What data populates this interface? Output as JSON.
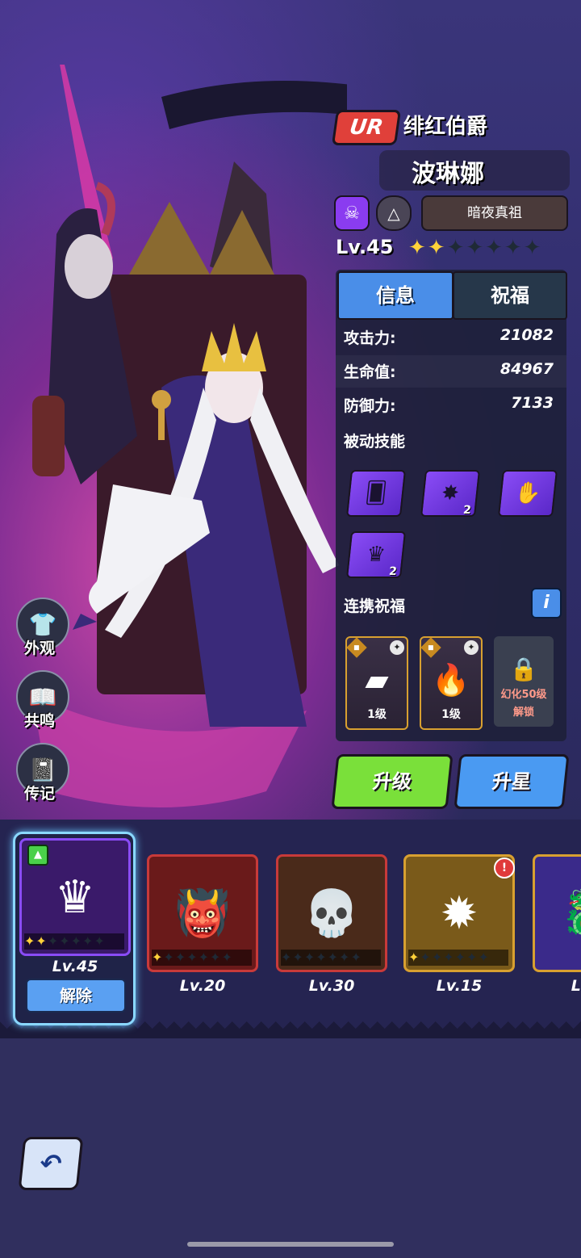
{
  "hero": {
    "rarity": "UR",
    "title": "绯红伯爵",
    "name": "波琳娜",
    "class_icon": "skull-icon",
    "type_icon": "triangle-icon",
    "faction": "暗夜真祖",
    "level": "Lv.45",
    "stars_filled": 2,
    "stars_total": 7
  },
  "tabs": {
    "info": "信息",
    "blessing": "祝福"
  },
  "stats": [
    {
      "label": "攻击力:",
      "value": "21082"
    },
    {
      "label": "生命值:",
      "value": "84967"
    },
    {
      "label": "防御力:",
      "value": "7133"
    }
  ],
  "passive": {
    "title": "被动技能",
    "skills": [
      {
        "icon": "cards-icon",
        "badge": ""
      },
      {
        "icon": "splash-icon",
        "badge": "2"
      },
      {
        "icon": "hand-icon",
        "badge": ""
      },
      {
        "icon": "crown-icon",
        "badge": "2"
      }
    ]
  },
  "link_blessing": {
    "title": "连携祝福",
    "info_label": "i",
    "cards": [
      {
        "icon": "gold-bars-icon",
        "level": "1级"
      },
      {
        "icon": "fire-demon-icon",
        "level": "1级"
      }
    ],
    "locked_line1": "幻化50级",
    "locked_line2": "解锁"
  },
  "buttons": {
    "upgrade": "升级",
    "star_up": "升星",
    "release": "解除"
  },
  "side_menu": {
    "appearance": "外观",
    "resonance": "共鸣",
    "biography": "传记"
  },
  "pets": [
    {
      "level": "Lv.45",
      "stars": 2,
      "equipped": true
    },
    {
      "level": "Lv.20",
      "stars": 1
    },
    {
      "level": "Lv.30",
      "stars": 0
    },
    {
      "level": "Lv.15",
      "stars": 1,
      "alert": "!"
    },
    {
      "level": "Lv",
      "stars": 0
    }
  ],
  "colors": {
    "accent_blue": "#4a9af2",
    "accent_green": "#7ae03a",
    "rarity_red": "#e0403a",
    "star_gold": "#ffd23a"
  }
}
